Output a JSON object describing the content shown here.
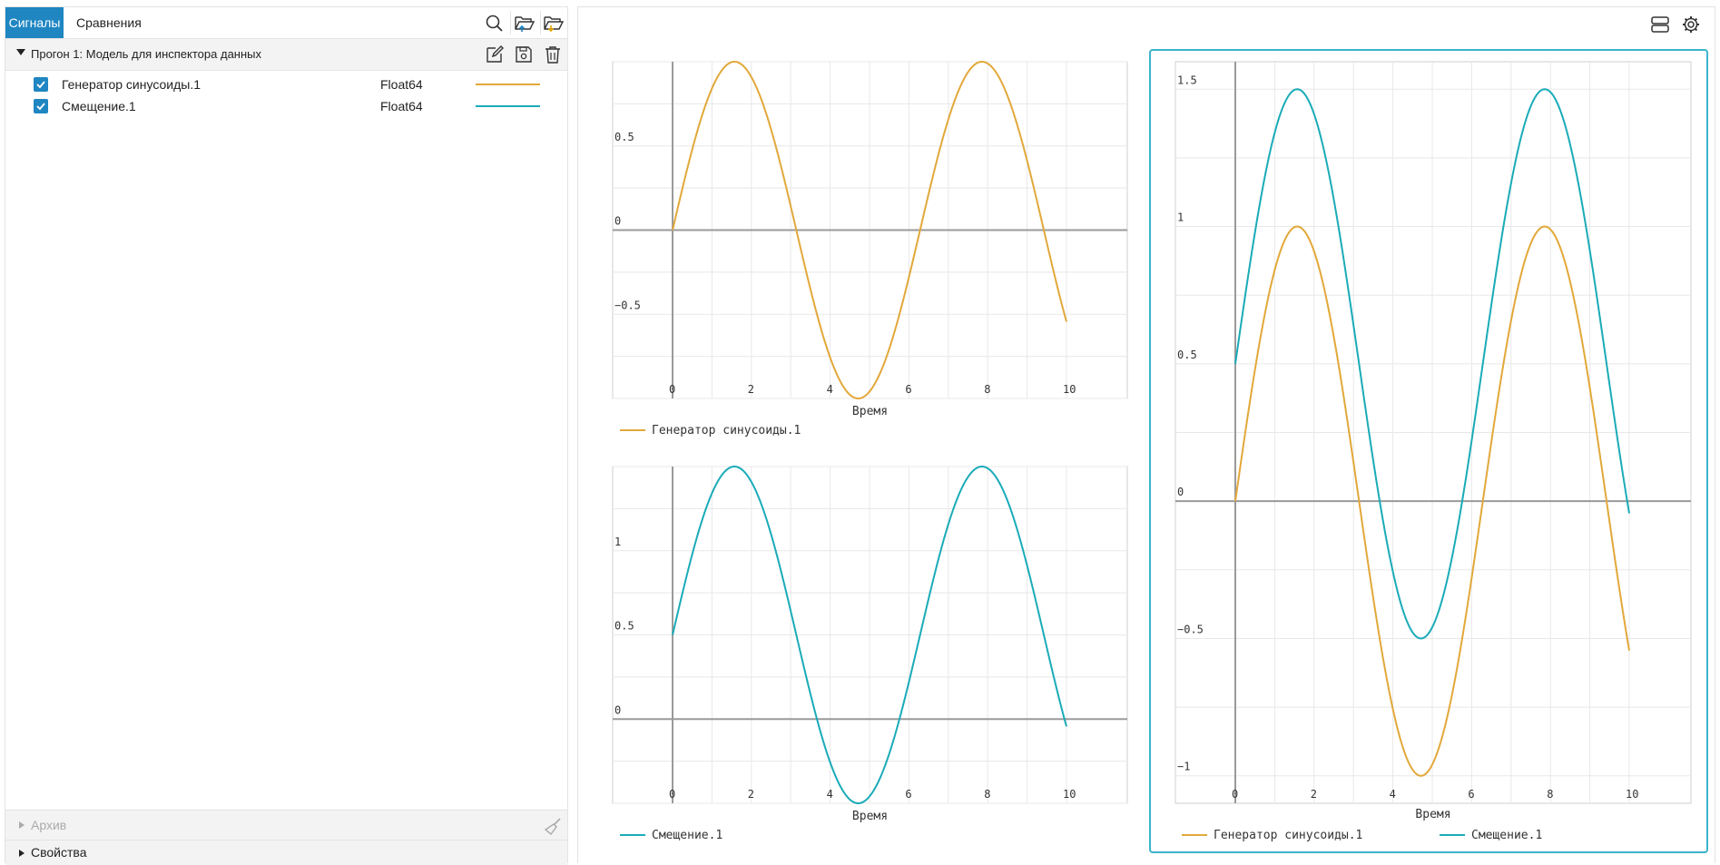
{
  "tabs": {
    "signals": "Сигналы",
    "comparisons": "Сравнения"
  },
  "run": {
    "title": "Прогон 1: Модель для инспектора данных",
    "signals": [
      {
        "name": "Генератор синусоиды.1",
        "type": "Float64",
        "checked": true,
        "color": "#e2a83a"
      },
      {
        "name": "Смещение.1",
        "type": "Float64",
        "checked": true,
        "color": "#1aabb8"
      }
    ]
  },
  "archive_label": "Архив",
  "properties_label": "Свойства",
  "colors": {
    "accent": "#1f86c2",
    "selected_border": "#3bb3cc",
    "sine": "#e2a83a",
    "offset": "#1aabb8"
  },
  "icons": [
    "search-icon",
    "folder-open-icon",
    "folder-import-icon",
    "edit-icon",
    "save-icon",
    "trash-icon",
    "broom-icon",
    "layout-icon",
    "gear-icon"
  ],
  "chart_data": [
    {
      "type": "line",
      "xlabel": "Время",
      "xlim": [
        0,
        10
      ],
      "ylim": [
        -1,
        1
      ],
      "x_ticks": [
        0,
        2,
        4,
        6,
        8,
        10
      ],
      "y_ticks": [
        -0.5,
        0,
        0.5
      ],
      "series": [
        {
          "name": "Генератор синусоиды.1",
          "function": "sin(t)",
          "amplitude": 1,
          "offset": 0,
          "color": "#e2a83a"
        }
      ],
      "grid": true
    },
    {
      "type": "line",
      "xlabel": "Время",
      "xlim": [
        0,
        10
      ],
      "ylim": [
        -0.5,
        1.5
      ],
      "x_ticks": [
        0,
        2,
        4,
        6,
        8,
        10
      ],
      "y_ticks": [
        0,
        0.5,
        1
      ],
      "series": [
        {
          "name": "Смещение.1",
          "function": "sin(t)+0.5",
          "amplitude": 1,
          "offset": 0.5,
          "color": "#1aabb8"
        }
      ],
      "grid": true
    },
    {
      "type": "line",
      "xlabel": "Время",
      "xlim": [
        0,
        10
      ],
      "ylim": [
        -1.1,
        1.6
      ],
      "x_ticks": [
        0,
        2,
        4,
        6,
        8,
        10
      ],
      "y_ticks": [
        -1,
        -0.5,
        0,
        0.5,
        1,
        1.5
      ],
      "series": [
        {
          "name": "Генератор синусоиды.1",
          "function": "sin(t)",
          "amplitude": 1,
          "offset": 0,
          "color": "#e2a83a"
        },
        {
          "name": "Смещение.1",
          "function": "sin(t)+0.5",
          "amplitude": 1,
          "offset": 0.5,
          "color": "#1aabb8"
        }
      ],
      "grid": true
    }
  ]
}
